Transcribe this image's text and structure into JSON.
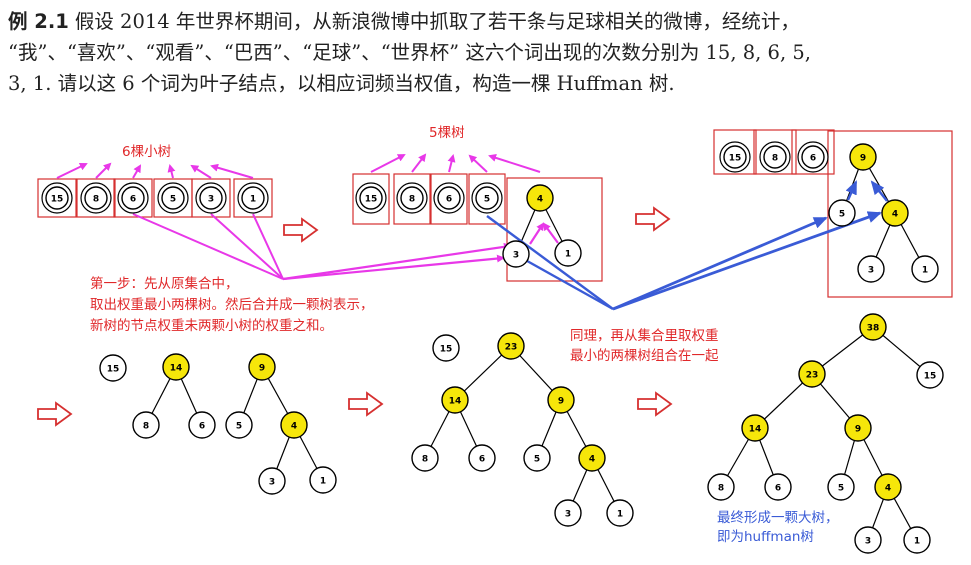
{
  "example": {
    "label": "例 2.1",
    "line1": "假设 2014 年世界杯期间，从新浪微博中抓取了若干条与足球相关的微博，经统计，",
    "line2": "“我”、“喜欢”、“观看”、“巴西”、“足球”、“世界杯” 这六个词出现的次数分别为 15, 8, 6, 5,",
    "line3": "3, 1. 请以这 6 个词为叶子结点，以相应词频当权值，构造一棵 Huffman 树."
  },
  "annotations": {
    "six_trees": "6棵小树",
    "five_trees": "5棵树",
    "step1_line1": "第一步：先从原集合中，",
    "step1_line2": "取出权重最小两棵树。然后合并成一颗树表示，",
    "step1_line3": "新树的节点权重未两颗小树的权重之和。",
    "repeat_line1": "同理，再从集合里取权重",
    "repeat_line2": "最小的两棵树组合在一起",
    "final_line1": "最终形成一颗大树，",
    "final_line2": "即为huffman树"
  },
  "colors": {
    "annotation_red": "#e0282a",
    "annotation_blue": "#3a5bd6",
    "magenta_arrow": "#e838e8",
    "blue_arrow": "#3a5bd6",
    "box_red": "#d63030",
    "node_yellow": "#f6e60a",
    "node_stroke": "#000000",
    "hollow_arrow": "#d63030"
  },
  "stage1_leaves": [
    "15",
    "8",
    "6",
    "5",
    "3",
    "1"
  ],
  "stage2": {
    "leaves": [
      "15",
      "8",
      "6",
      "5"
    ],
    "root": "4",
    "children": [
      "3",
      "1"
    ]
  },
  "stage3": {
    "leaves": [
      "15",
      "8",
      "6"
    ],
    "root": "9",
    "left": "5",
    "right": "4",
    "right_children": [
      "3",
      "1"
    ]
  },
  "stage4": {
    "single": "15",
    "treeA": {
      "root": "14",
      "children": [
        "8",
        "6"
      ]
    },
    "treeB": {
      "root": "9",
      "left": "5",
      "right": "4",
      "right_children": [
        "3",
        "1"
      ]
    }
  },
  "stage5": {
    "single": "15",
    "root": "23",
    "left": {
      "root": "14",
      "children": [
        "8",
        "6"
      ]
    },
    "right": {
      "root": "9",
      "left": "5",
      "right": "4",
      "right_children": [
        "3",
        "1"
      ]
    }
  },
  "stage6": {
    "root": "38",
    "right_leaf": "15",
    "sub": "23",
    "left": {
      "root": "14",
      "children": [
        "8",
        "6"
      ]
    },
    "right": {
      "root": "9",
      "left": "5",
      "right": "4",
      "right_children": [
        "3",
        "1"
      ]
    }
  }
}
